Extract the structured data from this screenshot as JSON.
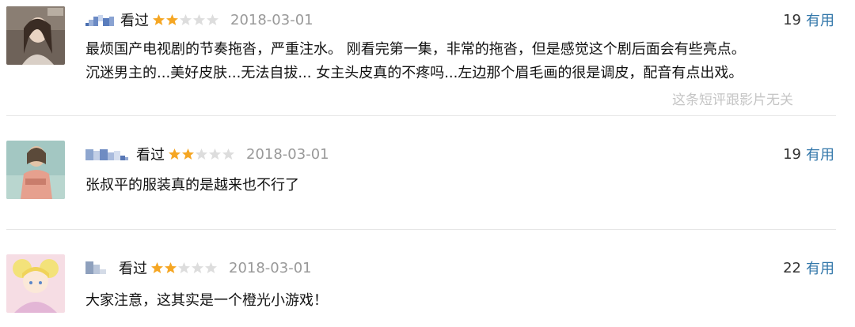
{
  "comments": [
    {
      "status": "看过",
      "rating": 2,
      "date": "2018-03-01",
      "votes": "19",
      "useful_label": "有用",
      "lines": [
        "最烦国产电视剧的节奏拖沓，严重注水。 刚看完第一集，非常的拖沓，但是感觉这个剧后面会有些亮点。",
        "沉迷男主的...美好皮肤...无法自拔... 女主头皮真的不疼吗...左边那个眉毛画的很是调皮，配音有点出戏。"
      ],
      "irrelevant_label": "这条短评跟影片无关"
    },
    {
      "status": "看过",
      "rating": 2,
      "date": "2018-03-01",
      "votes": "19",
      "useful_label": "有用",
      "lines": [
        "张叔平的服装真的是越来也不行了"
      ]
    },
    {
      "status": "看过",
      "rating": 2,
      "date": "2018-03-01",
      "votes": "22",
      "useful_label": "有用",
      "lines": [
        "大家注意，这其实是一个橙光小游戏！"
      ]
    }
  ],
  "colors": {
    "star_on": "#f5a623",
    "star_off": "#dddddd",
    "link": "#3377aa",
    "date": "#999999",
    "muted": "#c5c5c5"
  }
}
